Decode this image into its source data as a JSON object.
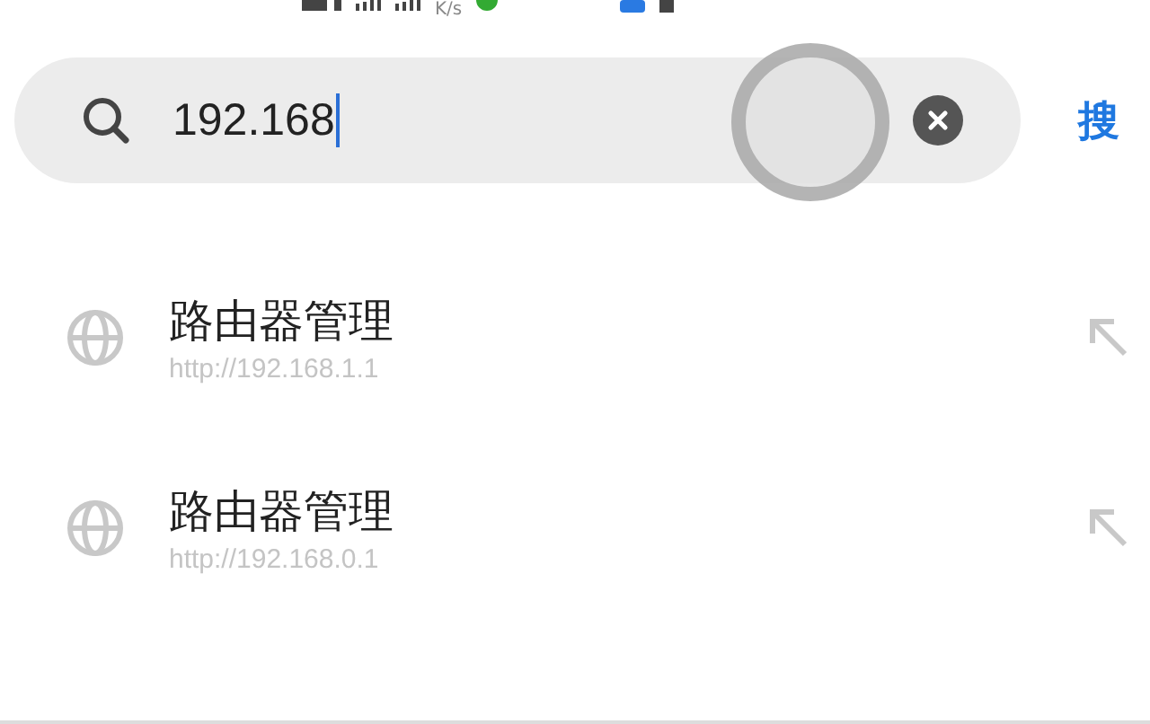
{
  "status_bar": {
    "speed_unit": "K/s"
  },
  "search": {
    "value": "192.168",
    "action": "搜"
  },
  "suggestions": [
    {
      "title": "路由器管理",
      "url": "http://192.168.1.1"
    },
    {
      "title": "路由器管理",
      "url": "http://192.168.0.1"
    }
  ]
}
